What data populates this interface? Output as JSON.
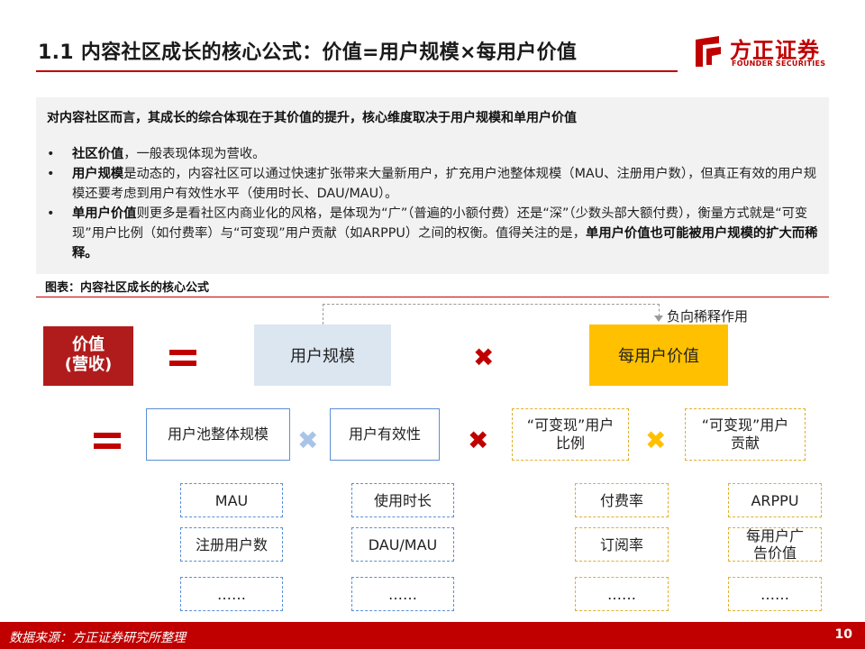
{
  "header": {
    "title": "1.1 内容社区成长的核心公式：价值=用户规模×每用户价值",
    "logo_cn": "方正证券",
    "logo_en": "FOUNDER SECURITIES"
  },
  "intro": {
    "heading": "对内容社区而言，其成长的综合体现在于其价值的提升，核心维度取决于用户规模和单用户价值",
    "bullets": [
      {
        "bold": "社区价值",
        "text": "，一般表现体现为营收。"
      },
      {
        "bold": "用户规模",
        "text": "是动态的，内容社区可以通过快速扩张带来大量新用户，扩充用户池整体规模（MAU、注册用户数），但真正有效的用户规模还要考虑到用户有效性水平（使用时长、DAU/MAU）。"
      },
      {
        "bold": "单用户价值",
        "text": "则更多是看社区内商业化的风格，是体现为“广”（普遍的小额付费）还是“深”（少数头部大额付费），衡量方式就是“可变现”用户比例（如付费率）与“可变现”用户贡献（如ARPPU）之间的权衡。值得关注的是，",
        "tail_bold": "单用户价值也可能被用户规模的扩大而稀释。"
      }
    ]
  },
  "figure": {
    "label": "图表：内容社区成长的核心公式",
    "dilution_label": "负向稀释作用",
    "value_box": [
      "价值",
      "(营收)"
    ],
    "row1": {
      "scale": "用户规模",
      "per_user": "每用户价值"
    },
    "row2": {
      "pool": "用户池整体规模",
      "effectiveness": "用户有效性",
      "monetizable_ratio": "“可变现”用户比例",
      "monetizable_contribution": "“可变现”用户贡献"
    },
    "leaves": {
      "pool": [
        "MAU",
        "注册用户数",
        "……"
      ],
      "effectiveness": [
        "使用时长",
        "DAU/MAU",
        "……"
      ],
      "ratio": [
        "付费率",
        "订阅率",
        "……"
      ],
      "contribution": [
        "ARPPU",
        "每用户广告价值",
        "……"
      ]
    },
    "colors": {
      "brand_red": "#c00000",
      "value_box": "#b01c1c",
      "scale_box": "#dce6f1",
      "per_user_box": "#ffc000",
      "blue_multiply": "#a9c4e6",
      "gold_multiply": "#ffc000"
    }
  },
  "footer": {
    "source": "数据来源：方正证券研究所整理",
    "page": "10"
  }
}
